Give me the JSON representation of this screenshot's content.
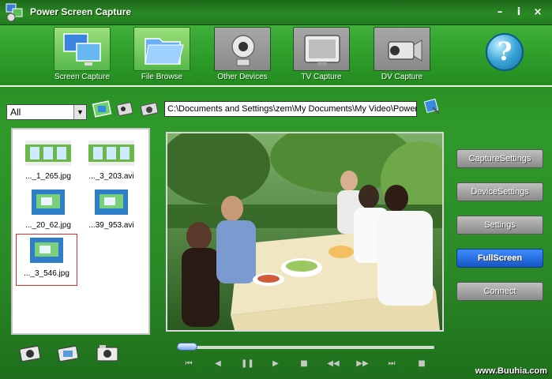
{
  "window": {
    "title": "Power Screen Capture"
  },
  "titlebar_buttons": [
    "–",
    "i",
    "×"
  ],
  "toolbar": {
    "items": [
      {
        "label": "Screen Capture",
        "icon": "screen-capture-icon",
        "active": true
      },
      {
        "label": "File Browse",
        "icon": "folder-icon",
        "active": true
      },
      {
        "label": "Other Devices",
        "icon": "webcam-icon",
        "active": false
      },
      {
        "label": "TV Capture",
        "icon": "tv-icon",
        "active": false
      },
      {
        "label": "DV Capture",
        "icon": "camcorder-icon",
        "active": false
      }
    ],
    "help_label": "?"
  },
  "filter": {
    "selected": "All",
    "arrow": "▼"
  },
  "path": {
    "value": "C:\\Documents and Settings\\zem\\My Documents\\My Video\\PowerS"
  },
  "files": [
    {
      "name": "..._1_265.jpg",
      "kind": "film"
    },
    {
      "name": "..._3_203.avi",
      "kind": "film"
    },
    {
      "name": "..._20_62.jpg",
      "kind": "screen"
    },
    {
      "name": "...39_953.avi",
      "kind": "screen"
    },
    {
      "name": "..._3_546.jpg",
      "kind": "screen",
      "selected": true
    }
  ],
  "side_buttons": [
    {
      "label": "CaptureSettings",
      "active": false
    },
    {
      "label": "DeviceSettings",
      "active": false
    },
    {
      "label": "Settings",
      "active": false
    },
    {
      "label": "FullScreen",
      "active": true
    },
    {
      "label": "Connect",
      "active": false
    }
  ],
  "playback": {
    "progress": 0.04,
    "buttons": [
      "skip-start",
      "prev",
      "pause",
      "play",
      "stop",
      "rewind",
      "fast-forward",
      "next",
      "record"
    ]
  },
  "watermark": "www.Buuhia.com",
  "colors": {
    "accent": "#1556c4",
    "bg": "#2f9a2a",
    "highlight": "#d43030"
  }
}
